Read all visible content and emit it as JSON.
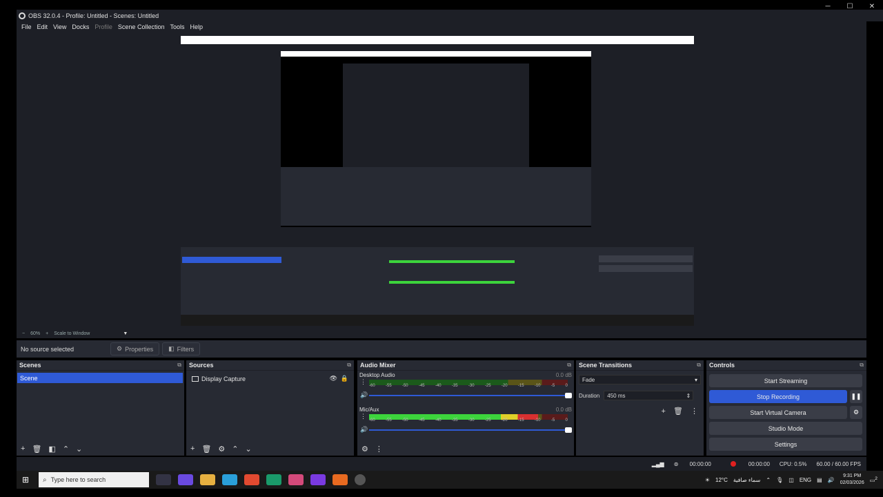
{
  "window": {
    "title": "OBS 32.0.4 - Profile: Untitled - Scenes: Untitled",
    "min": "─",
    "max": "☐",
    "close": "✕"
  },
  "menu": {
    "file": "File",
    "edit": "Edit",
    "view": "View",
    "docks": "Docks",
    "profile": "Profile",
    "scene_collection": "Scene Collection",
    "tools": "Tools",
    "help": "Help"
  },
  "zoom": {
    "minus": "−",
    "percent": "60%",
    "plus": "+",
    "mode": "Scale to Window",
    "caret": "▼"
  },
  "source_bar": {
    "no_source": "No source selected",
    "properties": "Properties",
    "filters": "Filters"
  },
  "scenes": {
    "title": "Scenes",
    "items": [
      "Scene"
    ]
  },
  "sources": {
    "title": "Sources",
    "items": [
      "Display Capture"
    ]
  },
  "mixer": {
    "title": "Audio Mixer",
    "ticks": [
      "-60",
      "-55",
      "-50",
      "-45",
      "-40",
      "-35",
      "-30",
      "-25",
      "-20",
      "-15",
      "-10",
      "-5",
      "0"
    ],
    "channels": [
      {
        "name": "Desktop Audio",
        "db": "0.0 dB",
        "level": 0.0,
        "volume": 1.0
      },
      {
        "name": "Mic/Aux",
        "db": "0.0 dB",
        "level": 0.85,
        "volume": 1.0
      }
    ]
  },
  "transitions": {
    "title": "Scene Transitions",
    "type": "Fade",
    "duration_label": "Duration",
    "duration": "450 ms"
  },
  "controls": {
    "title": "Controls",
    "start_streaming": "Start Streaming",
    "stop_recording": "Stop Recording",
    "start_virtual_camera": "Start Virtual Camera",
    "studio_mode": "Studio Mode",
    "settings": "Settings"
  },
  "status": {
    "stream_time": "00:00:00",
    "rec_time": "00:00:00",
    "cpu": "CPU: 0.5%",
    "fps": "60.00 / 60.00 FPS"
  },
  "taskbar": {
    "search_placeholder": "Type here to search",
    "weather": "12°C",
    "weather_text": "سماء صافية",
    "lang": "ENG",
    "time": "9:31 PM",
    "date": "02/03/2026",
    "notif_count": "2"
  },
  "colors": {
    "accent": "#2f5ad6",
    "panel": "#272a33",
    "bg": "#1d1f26",
    "rec": "#e02020"
  }
}
